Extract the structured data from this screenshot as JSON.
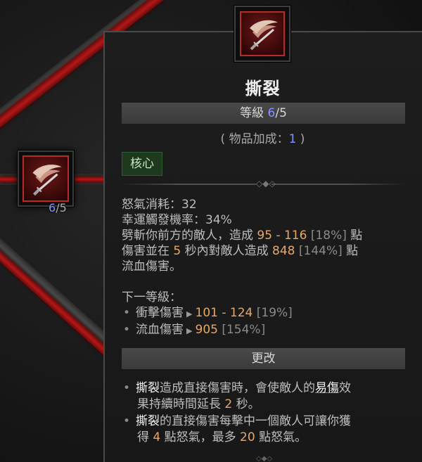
{
  "skill": {
    "name": "撕裂",
    "rank_label": "等級",
    "rank_current": "6",
    "rank_max": "/5",
    "bonus_prefix": "( 物品加成：",
    "bonus_value": "1",
    "bonus_suffix": " )",
    "tag": "核心"
  },
  "left_node": {
    "rank_current": "6",
    "rank_max": "/5"
  },
  "stats": {
    "fury_cost": "怒氣消耗：32",
    "lucky_hit": "幸運觸發機率：34%"
  },
  "description": {
    "part1": "劈斬你前方的敵人，造成 ",
    "damage_range": "95 - 116",
    "damage_pct": " [18%]",
    "part2": " 點",
    "part3": "傷害並在 ",
    "seconds": "5",
    "part4": " 秒內對敵人造成 ",
    "bleed": "848",
    "bleed_pct": " [144%]",
    "part5": " 點",
    "part6": "流血傷害。"
  },
  "next_rank": {
    "title": "下一等級：",
    "items": [
      {
        "label": "衝擊傷害",
        "value": "101 - 124",
        "pct": " [19%]"
      },
      {
        "label": "流血傷害",
        "value": "905",
        "pct": " [154%]"
      }
    ]
  },
  "changes": {
    "title": "更改",
    "line1_skill": "撕裂",
    "line1_a": "造成直接傷害時，會使敵人的",
    "line1_keyword": "易傷",
    "line1_b": "效",
    "line1_c": "果持續時間延長 ",
    "line1_num": "2",
    "line1_d": " 秒。",
    "line2_skill": "撕裂",
    "line2_a": "的直接傷害每擊中一個敵人可讓你獲",
    "line2_b": "得 ",
    "line2_num1": "4",
    "line2_c": " 點怒氣，最多 ",
    "line2_num2": "20",
    "line2_d": " 點怒氣。"
  },
  "icons": {
    "skill": "rend-slash-icon",
    "divider": "diamond-ornament-icon"
  },
  "colors": {
    "accent_blue": "#7f95ff",
    "damage_orange": "#e6a86a",
    "tag_green": "#1d3a1e",
    "skill_red": "#b92a2a"
  }
}
